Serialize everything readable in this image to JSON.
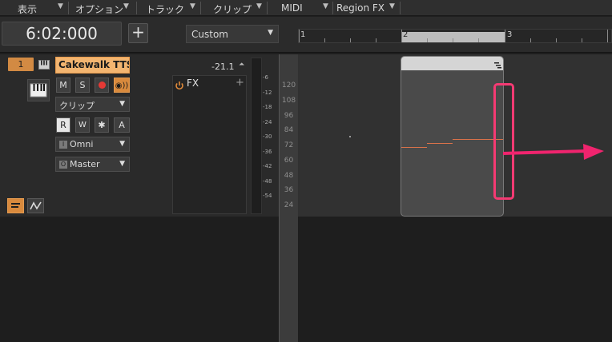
{
  "menu": {
    "items": [
      {
        "label": "表示"
      },
      {
        "label": "オプション"
      },
      {
        "label": "トラック"
      },
      {
        "label": "クリップ"
      },
      {
        "label": "MIDI"
      },
      {
        "label": "Region FX"
      }
    ]
  },
  "transport": {
    "time": "6:02:000",
    "add_label": "+"
  },
  "preset": {
    "selected": "Custom"
  },
  "ruler": {
    "marks": [
      "1",
      "2",
      "3"
    ]
  },
  "track": {
    "number": "1",
    "name": "Cakewalk TTS-",
    "buttons": {
      "mute": "M",
      "solo": "S"
    },
    "clip_select": "クリップ",
    "automation": {
      "read": "R",
      "write": "W",
      "star": "✱",
      "arm": "A"
    },
    "input": {
      "tag": "I",
      "label": "Omni"
    },
    "output": {
      "tag": "O",
      "label": "Master"
    },
    "volume": "-21.1",
    "fx_label": "FX",
    "fx_add": "+"
  },
  "meter": {
    "ticks": [
      "-6",
      "-12",
      "-18",
      "-24",
      "-30",
      "-36",
      "-42",
      "-48",
      "-54"
    ]
  },
  "piano_roll": {
    "note_labels": [
      "120",
      "108",
      "96",
      "84",
      "72",
      "60",
      "48",
      "36",
      "24"
    ]
  },
  "colors": {
    "track_accent": "#f3b570",
    "highlight": "#f53a73",
    "arrow": "#f0246e"
  }
}
